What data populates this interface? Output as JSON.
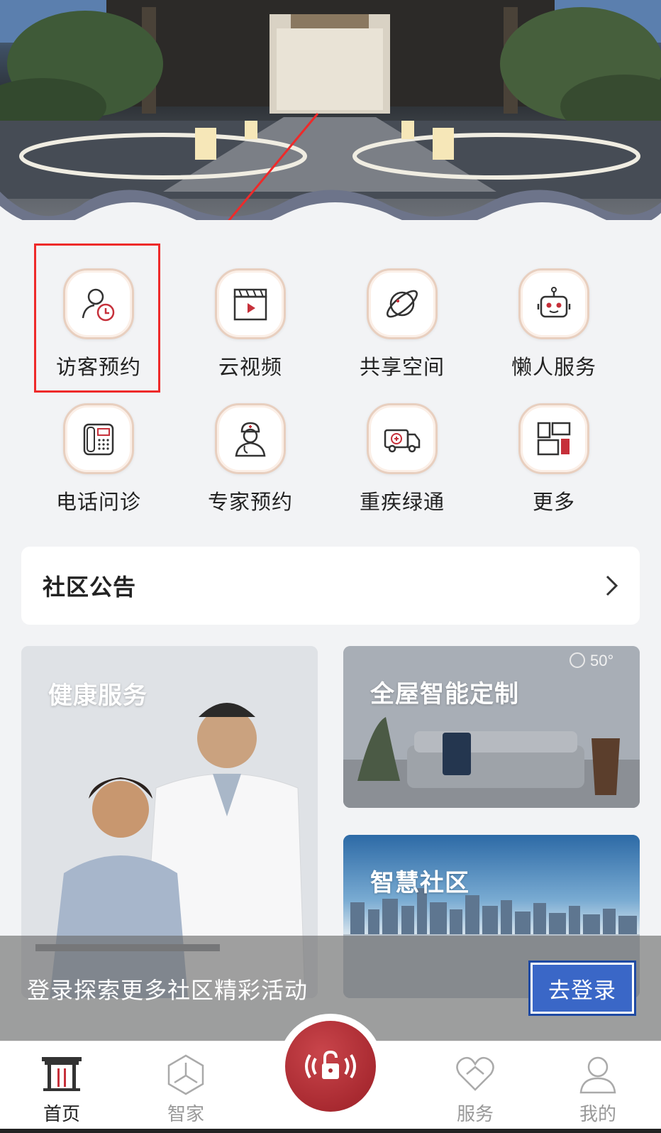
{
  "grid": {
    "items": [
      {
        "label": "访客预约",
        "icon": "visitor-clock-icon"
      },
      {
        "label": "云视频",
        "icon": "video-clapper-icon"
      },
      {
        "label": "共享空间",
        "icon": "planet-icon"
      },
      {
        "label": "懒人服务",
        "icon": "robot-icon"
      },
      {
        "label": "电话问诊",
        "icon": "telephone-icon"
      },
      {
        "label": "专家预约",
        "icon": "doctor-icon"
      },
      {
        "label": "重疾绿通",
        "icon": "ambulance-icon"
      },
      {
        "label": "更多",
        "icon": "more-grid-icon"
      }
    ]
  },
  "notice": {
    "title": "社区公告",
    "icon": "chevron-right-icon"
  },
  "cards": {
    "health": "健康服务",
    "smart_home": "全屋智能定制",
    "community": "智慧社区"
  },
  "login": {
    "text": "登录探索更多社区精彩活动",
    "button": "去登录"
  },
  "tabbar": {
    "home": "首页",
    "smart_home": "智家",
    "service": "服务",
    "mine": "我的"
  },
  "colors": {
    "accent_red": "#a92a31",
    "highlight": "#ee2a2a",
    "login_blue": "#3a67c7",
    "tile_border": "#e8cfbf"
  }
}
